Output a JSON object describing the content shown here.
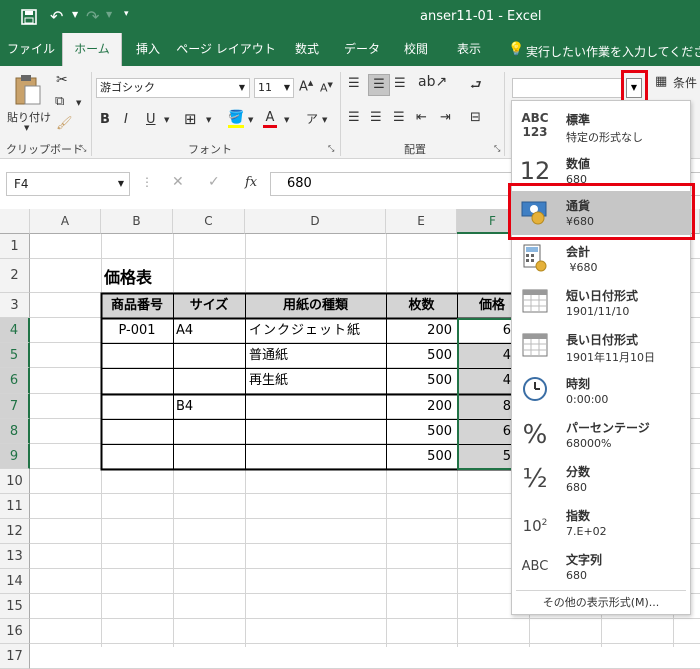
{
  "title_bar": {
    "title": "anser11-01 - Excel"
  },
  "tabs": [
    "ファイル",
    "ホーム",
    "挿入",
    "ページ レイアウト",
    "数式",
    "データ",
    "校閲",
    "表示"
  ],
  "tell_me": "実行したい作業を入力してください",
  "ribbon": {
    "paste_label": "貼り付け",
    "font_name": "游ゴシック",
    "font_size": "11",
    "groups": {
      "clipboard": "クリップボード",
      "font": "フォント",
      "alignment": "配置"
    },
    "bold": "B",
    "italic": "I",
    "underline": "U",
    "font_grow": "A",
    "font_shrink": "A",
    "conditional": "条件",
    "number_format_value": ""
  },
  "formula_bar": {
    "name_box": "F4",
    "value": "680",
    "fx": "fx"
  },
  "columns": [
    "A",
    "B",
    "C",
    "D",
    "E",
    "F"
  ],
  "rows": [
    "1",
    "2",
    "3",
    "4",
    "5",
    "6",
    "7",
    "8",
    "9",
    "10",
    "11",
    "12",
    "13",
    "14",
    "15",
    "16",
    "17"
  ],
  "sheet": {
    "title": "価格表",
    "headers": [
      "商品番号",
      "サイズ",
      "用紙の種類",
      "枚数",
      "価格"
    ],
    "cells": {
      "b4": "P-001",
      "c4": "A4",
      "d4": "インクジェット紙",
      "e4": "200",
      "f4": "6",
      "d5": "普通紙",
      "e5": "500",
      "f5": "4",
      "d6": "再生紙",
      "e6": "500",
      "f6": "4",
      "c7": "B4",
      "e7": "200",
      "f7": "8",
      "e8": "500",
      "f8": "6",
      "e9": "500",
      "f9": "5"
    }
  },
  "number_formats": [
    {
      "icon": "ABC 123",
      "name": "標準",
      "example": "特定の形式なし"
    },
    {
      "icon": "12",
      "name": "数値",
      "example": "680"
    },
    {
      "icon": "money",
      "name": "通貨",
      "example": "¥680"
    },
    {
      "icon": "calc",
      "name": "会計",
      "example": " ¥680"
    },
    {
      "icon": "cal",
      "name": "短い日付形式",
      "example": "1901/11/10"
    },
    {
      "icon": "cal",
      "name": "長い日付形式",
      "example": "1901年11月10日"
    },
    {
      "icon": "clock",
      "name": "時刻",
      "example": "0:00:00"
    },
    {
      "icon": "%",
      "name": "パーセンテージ",
      "example": "68000%"
    },
    {
      "icon": "½",
      "name": "分数",
      "example": "680"
    },
    {
      "icon": "10²",
      "name": "指数",
      "example": "7.E+02"
    },
    {
      "icon": "ABC",
      "name": "文字列",
      "example": "680"
    }
  ],
  "more_formats": "その他の表示形式(M)...",
  "colors": {
    "excel_green": "#217346",
    "highlight_red": "#e6000f",
    "selected_item": "#c6c6c6",
    "grey_fill": "#d4d4d4"
  }
}
